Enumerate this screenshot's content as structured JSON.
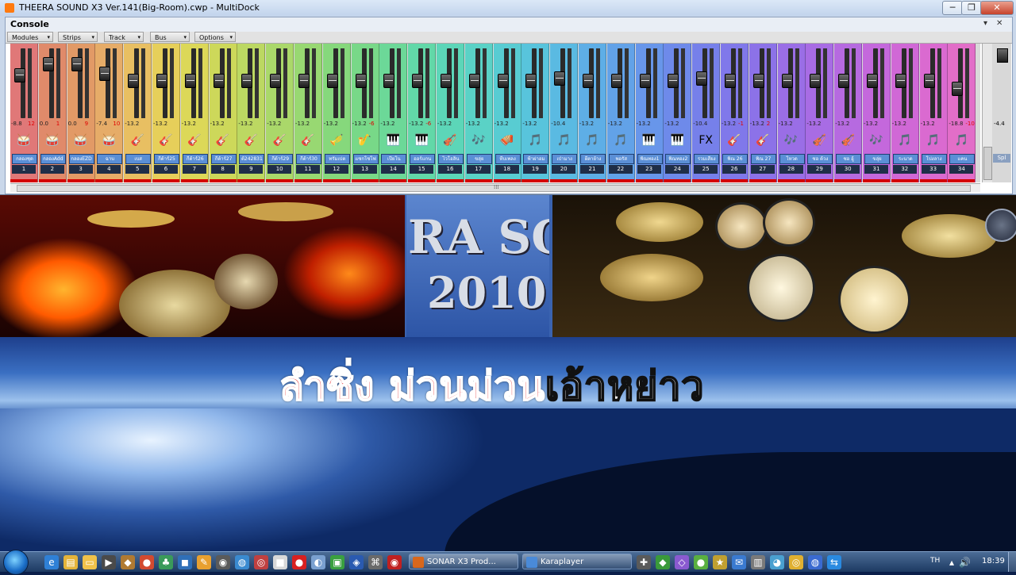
{
  "window": {
    "title": "THEERA SOUND X3 Ver.141(Big-Room).cwp - MultiDock",
    "min_label": "─",
    "max_label": "❐",
    "close_label": "✕"
  },
  "console": {
    "label": "Console",
    "ctl_dropdown": "▾",
    "ctl_close": "✕",
    "menus": [
      {
        "label": "Modules"
      },
      {
        "label": "Strips"
      },
      {
        "label": "Track"
      },
      {
        "label": "Bus"
      },
      {
        "label": "Options"
      }
    ],
    "menu_arrow": "▾",
    "scroll_grip": "⁞⁞⁞",
    "master_label": "Spl",
    "master_value": "-4.4",
    "strips": [
      {
        "name": "กลองชุด",
        "num": "1",
        "vol": "-8.8",
        "peak": "12",
        "icon": "drum-kit-icon",
        "glyph": "🥁",
        "color": "#e07878",
        "fader": 0.35
      },
      {
        "name": "กลองAdd",
        "num": "2",
        "vol": "0.0",
        "peak": "1",
        "icon": "drum-kit-icon",
        "glyph": "🥁",
        "color": "#e08a6a",
        "fader": 0.15
      },
      {
        "name": "กลองEZD",
        "num": "3",
        "vol": "0.0",
        "peak": "9",
        "icon": "drum-kit-icon",
        "glyph": "🥁",
        "color": "#e29a66",
        "fader": 0.15
      },
      {
        "name": "ฉาบ",
        "num": "4",
        "vol": "-7.4",
        "peak": "10",
        "icon": "drum-icon",
        "glyph": "🥁",
        "color": "#e6ac68",
        "fader": 0.32
      },
      {
        "name": "เบส",
        "num": "5",
        "vol": "-13.2",
        "peak": "",
        "icon": "bass-guitar-icon",
        "glyph": "🎸",
        "color": "#e8bf62",
        "fader": 0.45
      },
      {
        "name": "กีต้าร์25",
        "num": "6",
        "vol": "-13.2",
        "peak": "",
        "icon": "guitar-icon",
        "glyph": "🎸",
        "color": "#e6cf5a",
        "fader": 0.45
      },
      {
        "name": "กีต้าร์26",
        "num": "7",
        "vol": "-13.2",
        "peak": "",
        "icon": "guitar-icon",
        "glyph": "🎸",
        "color": "#dcd858",
        "fader": 0.45
      },
      {
        "name": "กีต้าร์27",
        "num": "8",
        "vol": "-13.2",
        "peak": "",
        "icon": "guitar-icon",
        "glyph": "🎸",
        "color": "#cdd85a",
        "fader": 0.45
      },
      {
        "name": "ต้242831",
        "num": "9",
        "vol": "-13.2",
        "peak": "",
        "icon": "guitar-icon",
        "glyph": "🎸",
        "color": "#bcd862",
        "fader": 0.45
      },
      {
        "name": "กีต้าร์29",
        "num": "10",
        "vol": "-13.2",
        "peak": "",
        "icon": "electric-guitar-icon",
        "glyph": "🎸",
        "color": "#aad86a",
        "fader": 0.45
      },
      {
        "name": "กีต้าร์30",
        "num": "11",
        "vol": "-13.2",
        "peak": "",
        "icon": "guitar-icon",
        "glyph": "🎸",
        "color": "#98d872",
        "fader": 0.45
      },
      {
        "name": "ทรัมเปต",
        "num": "12",
        "vol": "-13.2",
        "peak": "",
        "icon": "trumpet-icon",
        "glyph": "🎺",
        "color": "#86d87c",
        "fader": 0.45
      },
      {
        "name": "แซกโซโฟ",
        "num": "13",
        "vol": "-13.2",
        "peak": "-6",
        "icon": "saxophone-icon",
        "glyph": "🎷",
        "color": "#78d888",
        "fader": 0.45
      },
      {
        "name": "เปียโน",
        "num": "14",
        "vol": "-13.2",
        "peak": "",
        "icon": "piano-icon",
        "glyph": "🎹",
        "color": "#6cd898",
        "fader": 0.45
      },
      {
        "name": "ออร์แกน",
        "num": "15",
        "vol": "-13.2",
        "peak": "-6",
        "icon": "organ-icon",
        "glyph": "🎹",
        "color": "#62d8a8",
        "fader": 0.45
      },
      {
        "name": "ไวโอลิน",
        "num": "16",
        "vol": "-13.2",
        "peak": "",
        "icon": "violin-icon",
        "glyph": "🎻",
        "color": "#5cd6b8",
        "fader": 0.45
      },
      {
        "name": "ขลุ่ย",
        "num": "17",
        "vol": "-13.2",
        "peak": "",
        "icon": "flute-icon",
        "glyph": "🎶",
        "color": "#5ad2c6",
        "fader": 0.45
      },
      {
        "name": "หีบเพลง",
        "num": "18",
        "vol": "-13.2",
        "peak": "",
        "icon": "accordion-icon",
        "glyph": "🪗",
        "color": "#58ccd2",
        "fader": 0.45
      },
      {
        "name": "ฟ้าผ่าอม",
        "num": "19",
        "vol": "-13.2",
        "peak": "",
        "icon": "harmonica-icon",
        "glyph": "🎵",
        "color": "#58c4dc",
        "fader": 0.45
      },
      {
        "name": "เป่ามาง",
        "num": "20",
        "vol": "-10.4",
        "peak": "",
        "icon": "pipe-icon",
        "glyph": "🎵",
        "color": "#5abae2",
        "fader": 0.4
      },
      {
        "name": "ผีตาย้าง",
        "num": "21",
        "vol": "-13.2",
        "peak": "",
        "icon": "xylophone-icon",
        "glyph": "🎵",
        "color": "#5eaee6",
        "fader": 0.45
      },
      {
        "name": "พอรัส",
        "num": "22",
        "vol": "-13.2",
        "peak": "",
        "icon": "harp-icon",
        "glyph": "🎵",
        "color": "#62a2e8",
        "fader": 0.45
      },
      {
        "name": "พิณทอง1",
        "num": "23",
        "vol": "-13.2",
        "peak": "",
        "icon": "keyboard-icon",
        "glyph": "🎹",
        "color": "#6896ea",
        "fader": 0.45
      },
      {
        "name": "พิณทอง2",
        "num": "24",
        "vol": "-13.2",
        "peak": "",
        "icon": "synth-icon",
        "glyph": "🎹",
        "color": "#6e8aea",
        "fader": 0.45
      },
      {
        "name": "รวมเสียง",
        "num": "25",
        "vol": "-10.4",
        "peak": "",
        "icon": "fx-icon",
        "glyph": "FX",
        "color": "#7680ea",
        "fader": 0.4
      },
      {
        "name": "พิณ 26",
        "num": "26",
        "vol": "-13.2",
        "peak": "-1",
        "icon": "phin-icon",
        "glyph": "🎸",
        "color": "#8078ea",
        "fader": 0.45
      },
      {
        "name": "พิณ 27",
        "num": "27",
        "vol": "-13.2",
        "peak": "2",
        "icon": "phin-icon",
        "glyph": "🎸",
        "color": "#8c72e8",
        "fader": 0.45
      },
      {
        "name": "โหวด",
        "num": "28",
        "vol": "-13.2",
        "peak": "",
        "icon": "flute-icon",
        "glyph": "🎶",
        "color": "#9a6ee6",
        "fader": 0.45
      },
      {
        "name": "ซอ ด้วง",
        "num": "29",
        "vol": "-13.2",
        "peak": "",
        "icon": "fiddle-icon",
        "glyph": "🎻",
        "color": "#a86ce4",
        "fader": 0.45
      },
      {
        "name": "ซอ อู้",
        "num": "30",
        "vol": "-13.2",
        "peak": "",
        "icon": "fiddle-icon",
        "glyph": "🎻",
        "color": "#b66ae0",
        "fader": 0.45
      },
      {
        "name": "ขลุ่ย",
        "num": "31",
        "vol": "-13.2",
        "peak": "",
        "icon": "flute-icon",
        "glyph": "🎶",
        "color": "#c468dc",
        "fader": 0.45
      },
      {
        "name": "ระนาด",
        "num": "32",
        "vol": "-13.2",
        "peak": "",
        "icon": "ranat-icon",
        "glyph": "🎵",
        "color": "#d068d6",
        "fader": 0.45
      },
      {
        "name": "โปงลาง",
        "num": "33",
        "vol": "-13.2",
        "peak": "",
        "icon": "ponglang-icon",
        "glyph": "🎵",
        "color": "#da6ad0",
        "fader": 0.45
      },
      {
        "name": "แคน",
        "num": "34",
        "vol": "-18.8",
        "peak": "-10",
        "icon": "khaen-icon",
        "glyph": "🎵",
        "color": "#e26ec8",
        "fader": 0.58
      }
    ]
  },
  "background": {
    "logo_line1": "RA SO",
    "logo_line2": "2010"
  },
  "lyric": {
    "sung": "ลำซิ่ง ม่วนม่วน",
    "rest": "เอ้าหย่าว"
  },
  "taskbar": {
    "tasks": [
      {
        "label": "SONAR X3 Prod...",
        "color": "#d8671c"
      },
      {
        "label": "Karaplayer",
        "color": "#4a8ad8"
      }
    ],
    "language": "TH",
    "clock": "18:39"
  },
  "colors": {
    "strip_foot": "#d40000",
    "name_label": "#5b8fd6",
    "lyric_sung": "#e01c1c"
  }
}
